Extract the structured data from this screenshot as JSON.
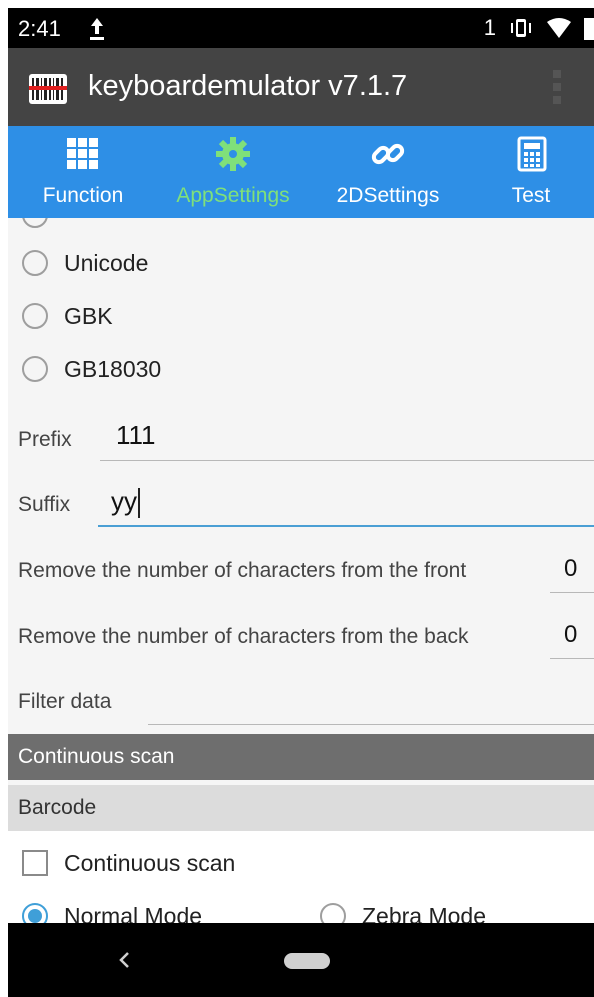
{
  "status": {
    "time": "2:41",
    "notification_count": "1"
  },
  "app": {
    "title": "keyboardemulator v7.1.7"
  },
  "tabs": [
    {
      "label": "Function",
      "icon": "grid-icon",
      "active": false
    },
    {
      "label": "AppSettings",
      "icon": "gear-icon",
      "active": true
    },
    {
      "label": "2DSettings",
      "icon": "link-icon",
      "active": false
    },
    {
      "label": "Test",
      "icon": "calculator-icon",
      "active": false
    }
  ],
  "encoding_options": [
    {
      "label": "Unicode",
      "selected": false
    },
    {
      "label": "GBK",
      "selected": false
    },
    {
      "label": "GB18030",
      "selected": false
    }
  ],
  "prefix": {
    "label": "Prefix",
    "value": "111"
  },
  "suffix": {
    "label": "Suffix",
    "value": "yy"
  },
  "remove_front": {
    "label": "Remove the number of characters from the front",
    "value": "0"
  },
  "remove_back": {
    "label": "Remove the number of characters from the back",
    "value": "0"
  },
  "filter": {
    "label": "Filter data",
    "value": ""
  },
  "continuous_section": {
    "header": "Continuous scan",
    "subheader": "Barcode"
  },
  "continuous_checkbox": {
    "label": "Continuous scan",
    "checked": false
  },
  "modes": [
    {
      "label": "Normal Mode",
      "selected": true
    },
    {
      "label": "Zebra Mode",
      "selected": false
    }
  ],
  "colors": {
    "tab_bar": "#2e8fe6",
    "tab_active": "#7fe07a",
    "app_bar": "#444444",
    "accent": "#3f9fd8",
    "section_header": "#6e6e6e"
  }
}
